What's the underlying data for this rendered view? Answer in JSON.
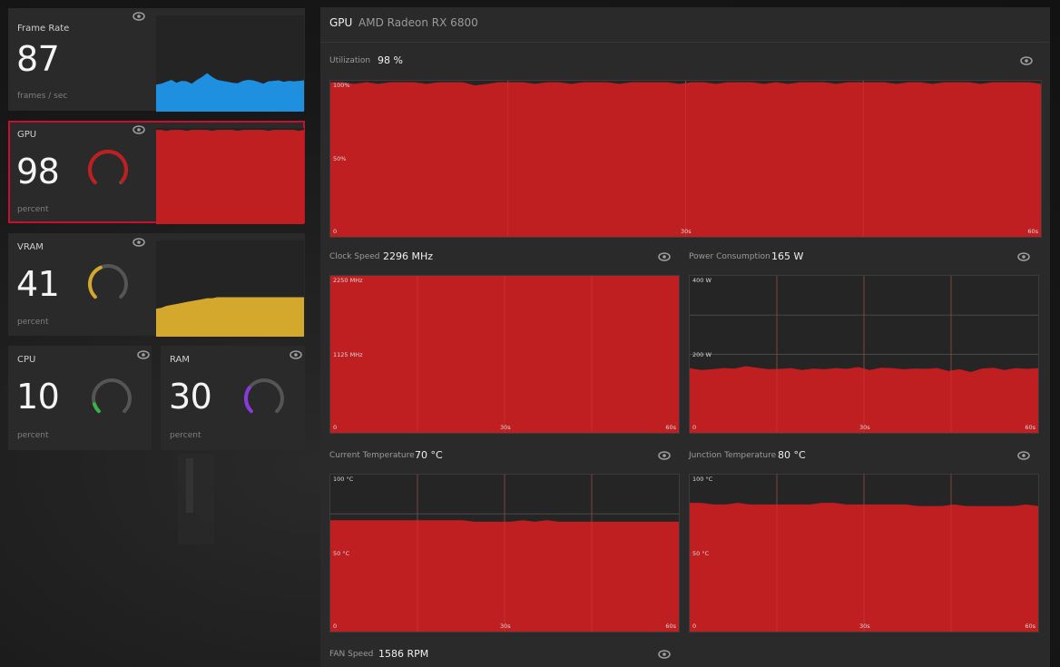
{
  "colors": {
    "red": "#c01f22",
    "blue": "#1f8fdf",
    "yellow": "#d4a82c",
    "green": "#38b24a",
    "purple": "#8a39e0",
    "track": "#555555",
    "grid": "#4a4a4a"
  },
  "icons": {
    "eye": "eye-icon"
  },
  "cards": {
    "framerate": {
      "title": "Frame Rate",
      "value": "87",
      "unit": "frames / sec"
    },
    "gpu": {
      "title": "GPU",
      "value": "98",
      "unit": "percent",
      "gauge_level": 0.98
    },
    "vram": {
      "title": "VRAM",
      "value": "41",
      "unit": "percent",
      "gauge_level": 0.41
    },
    "cpu": {
      "title": "CPU",
      "value": "10",
      "unit": "percent",
      "gauge_level": 0.1
    },
    "ram": {
      "title": "RAM",
      "value": "30",
      "unit": "percent",
      "gauge_level": 0.3
    }
  },
  "panel": {
    "title": "GPU",
    "device": "AMD Radeon RX 6800",
    "utilization": {
      "label": "Utilization",
      "value": "98 %",
      "ticks": {
        "top": "100%",
        "mid": "50%",
        "zero": "0",
        "x_mid": "30s",
        "x_end": "60s"
      }
    },
    "clock": {
      "label": "Clock Speed",
      "value": "2296 MHz",
      "ticks": {
        "top": "2250 MHz",
        "mid": "1125 MHz",
        "zero": "0",
        "x_mid": "30s",
        "x_end": "60s"
      }
    },
    "power": {
      "label": "Power Consumption",
      "value": "165 W",
      "ticks": {
        "top": "400 W",
        "mid": "200 W",
        "zero": "0",
        "x_mid": "30s",
        "x_end": "60s"
      }
    },
    "temp": {
      "label": "Current Temperature",
      "value": "70 °C",
      "ticks": {
        "top": "100 °C",
        "mid": "50 °C",
        "zero": "0",
        "x_mid": "30s",
        "x_end": "60s"
      }
    },
    "junction": {
      "label": "Junction Temperature",
      "value": "80 °C",
      "ticks": {
        "top": "100 °C",
        "mid": "50 °C",
        "zero": "0",
        "x_mid": "30s",
        "x_end": "60s"
      }
    },
    "fan": {
      "label": "FAN Speed",
      "value": "1586 RPM"
    }
  },
  "chart_data": [
    {
      "id": "framerate",
      "type": "area",
      "ylim": [
        0,
        200
      ],
      "values": [
        56,
        58,
        62,
        66,
        60,
        64,
        63,
        58,
        66,
        72,
        80,
        72,
        66,
        64,
        62,
        60,
        59,
        64,
        66,
        65,
        62,
        58,
        63,
        64,
        65,
        62,
        64,
        63,
        64,
        65
      ]
    },
    {
      "id": "gpu_spark",
      "type": "area",
      "ylim": [
        0,
        100
      ],
      "values": [
        98,
        98,
        97,
        98,
        98,
        98,
        97,
        98,
        98,
        98,
        98,
        97,
        98,
        98,
        98,
        98,
        97,
        98,
        98,
        98,
        98,
        98,
        97,
        98,
        98,
        98,
        98,
        98,
        97,
        98
      ]
    },
    {
      "id": "vram_spark",
      "type": "area",
      "ylim": [
        0,
        100
      ],
      "values": [
        29,
        30,
        32,
        33,
        34,
        35,
        36,
        37,
        38,
        39,
        40,
        40,
        41,
        41,
        41,
        41,
        41,
        41,
        41,
        41,
        41,
        41,
        41,
        41,
        41,
        41,
        41,
        41,
        41,
        41
      ]
    },
    {
      "id": "utilization",
      "type": "area",
      "ylim": [
        0,
        100
      ],
      "values": [
        99,
        99,
        98,
        99,
        98,
        99,
        99,
        99,
        98,
        99,
        99,
        99,
        97,
        98,
        99,
        99,
        99,
        98,
        99,
        99,
        98,
        99,
        99,
        99,
        98,
        99,
        99,
        99,
        99,
        98,
        99,
        99,
        98,
        99,
        99,
        99,
        98,
        99,
        98,
        99,
        99,
        99,
        98,
        99,
        99,
        99,
        99,
        98,
        99,
        99,
        98,
        99,
        99,
        99,
        98,
        99,
        99,
        99,
        99,
        98
      ]
    },
    {
      "id": "clock",
      "type": "area",
      "ylim": [
        0,
        2250
      ],
      "values": [
        2250,
        2250,
        2250,
        2250,
        2250,
        2250,
        2250,
        2250,
        2250,
        2250,
        2250,
        2250,
        2250,
        2250,
        2250,
        2250,
        2250,
        2250,
        2250,
        2250,
        2250,
        2250,
        2250,
        2250,
        2250,
        2250,
        2250,
        2250,
        2250,
        2250
      ]
    },
    {
      "id": "power",
      "type": "area",
      "ylim": [
        0,
        400
      ],
      "values": [
        165,
        160,
        162,
        165,
        164,
        170,
        166,
        162,
        163,
        165,
        160,
        164,
        162,
        165,
        163,
        168,
        160,
        166,
        165,
        162,
        164,
        163,
        165,
        158,
        162,
        155,
        164,
        166,
        160,
        165,
        163,
        165
      ]
    },
    {
      "id": "temp",
      "type": "area",
      "ylim": [
        0,
        100
      ],
      "values": [
        71,
        71,
        71,
        71,
        71,
        71,
        71,
        71,
        71,
        71,
        71,
        71,
        70,
        70,
        70,
        70,
        71,
        70,
        71,
        70,
        70,
        70,
        70,
        70,
        70,
        70,
        70,
        70,
        70,
        70
      ]
    },
    {
      "id": "junction",
      "type": "area",
      "ylim": [
        0,
        100
      ],
      "values": [
        82,
        82,
        81,
        81,
        82,
        81,
        81,
        81,
        81,
        81,
        81,
        82,
        82,
        81,
        81,
        81,
        81,
        81,
        81,
        80,
        80,
        80,
        81,
        80,
        80,
        80,
        80,
        80,
        81,
        80
      ]
    }
  ]
}
